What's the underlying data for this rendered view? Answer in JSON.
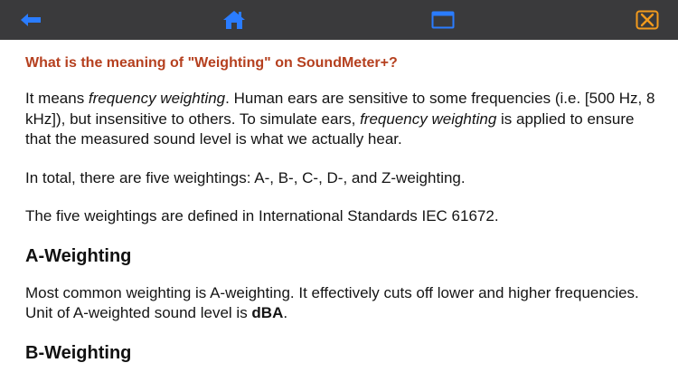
{
  "toolbar": {
    "icons": [
      "back-arrow-icon",
      "home-icon",
      "window-icon",
      "close-icon"
    ],
    "icon_color": "#2a7cff",
    "close_color": "#f29a1d",
    "background": "#3a3a3c"
  },
  "article": {
    "question": "What is the meaning of \"Weighting\" on SoundMeter+?",
    "p1": {
      "a": "It means ",
      "b": "frequency weighting",
      "c": ". Human ears are sensitive to some frequencies (i.e. [500 Hz, 8 kHz]), but insensitive to others. To simulate ears, ",
      "d": "frequency weighting",
      "e": " is applied to ensure that the measured sound level is what we actually hear."
    },
    "p2": "In total, there are five weightings: A-, B-, C-, D-, and Z-weighting.",
    "p3": "The five weightings are defined in International Standards IEC 61672.",
    "section_a": {
      "heading": "A-Weighting",
      "text_a": "Most common weighting is A-weighting. It effectively cuts off lower and higher frequencies. Unit of A-weighted sound level is ",
      "text_b": "dBA",
      "text_c": "."
    },
    "section_b": {
      "heading": "B-Weighting"
    }
  }
}
